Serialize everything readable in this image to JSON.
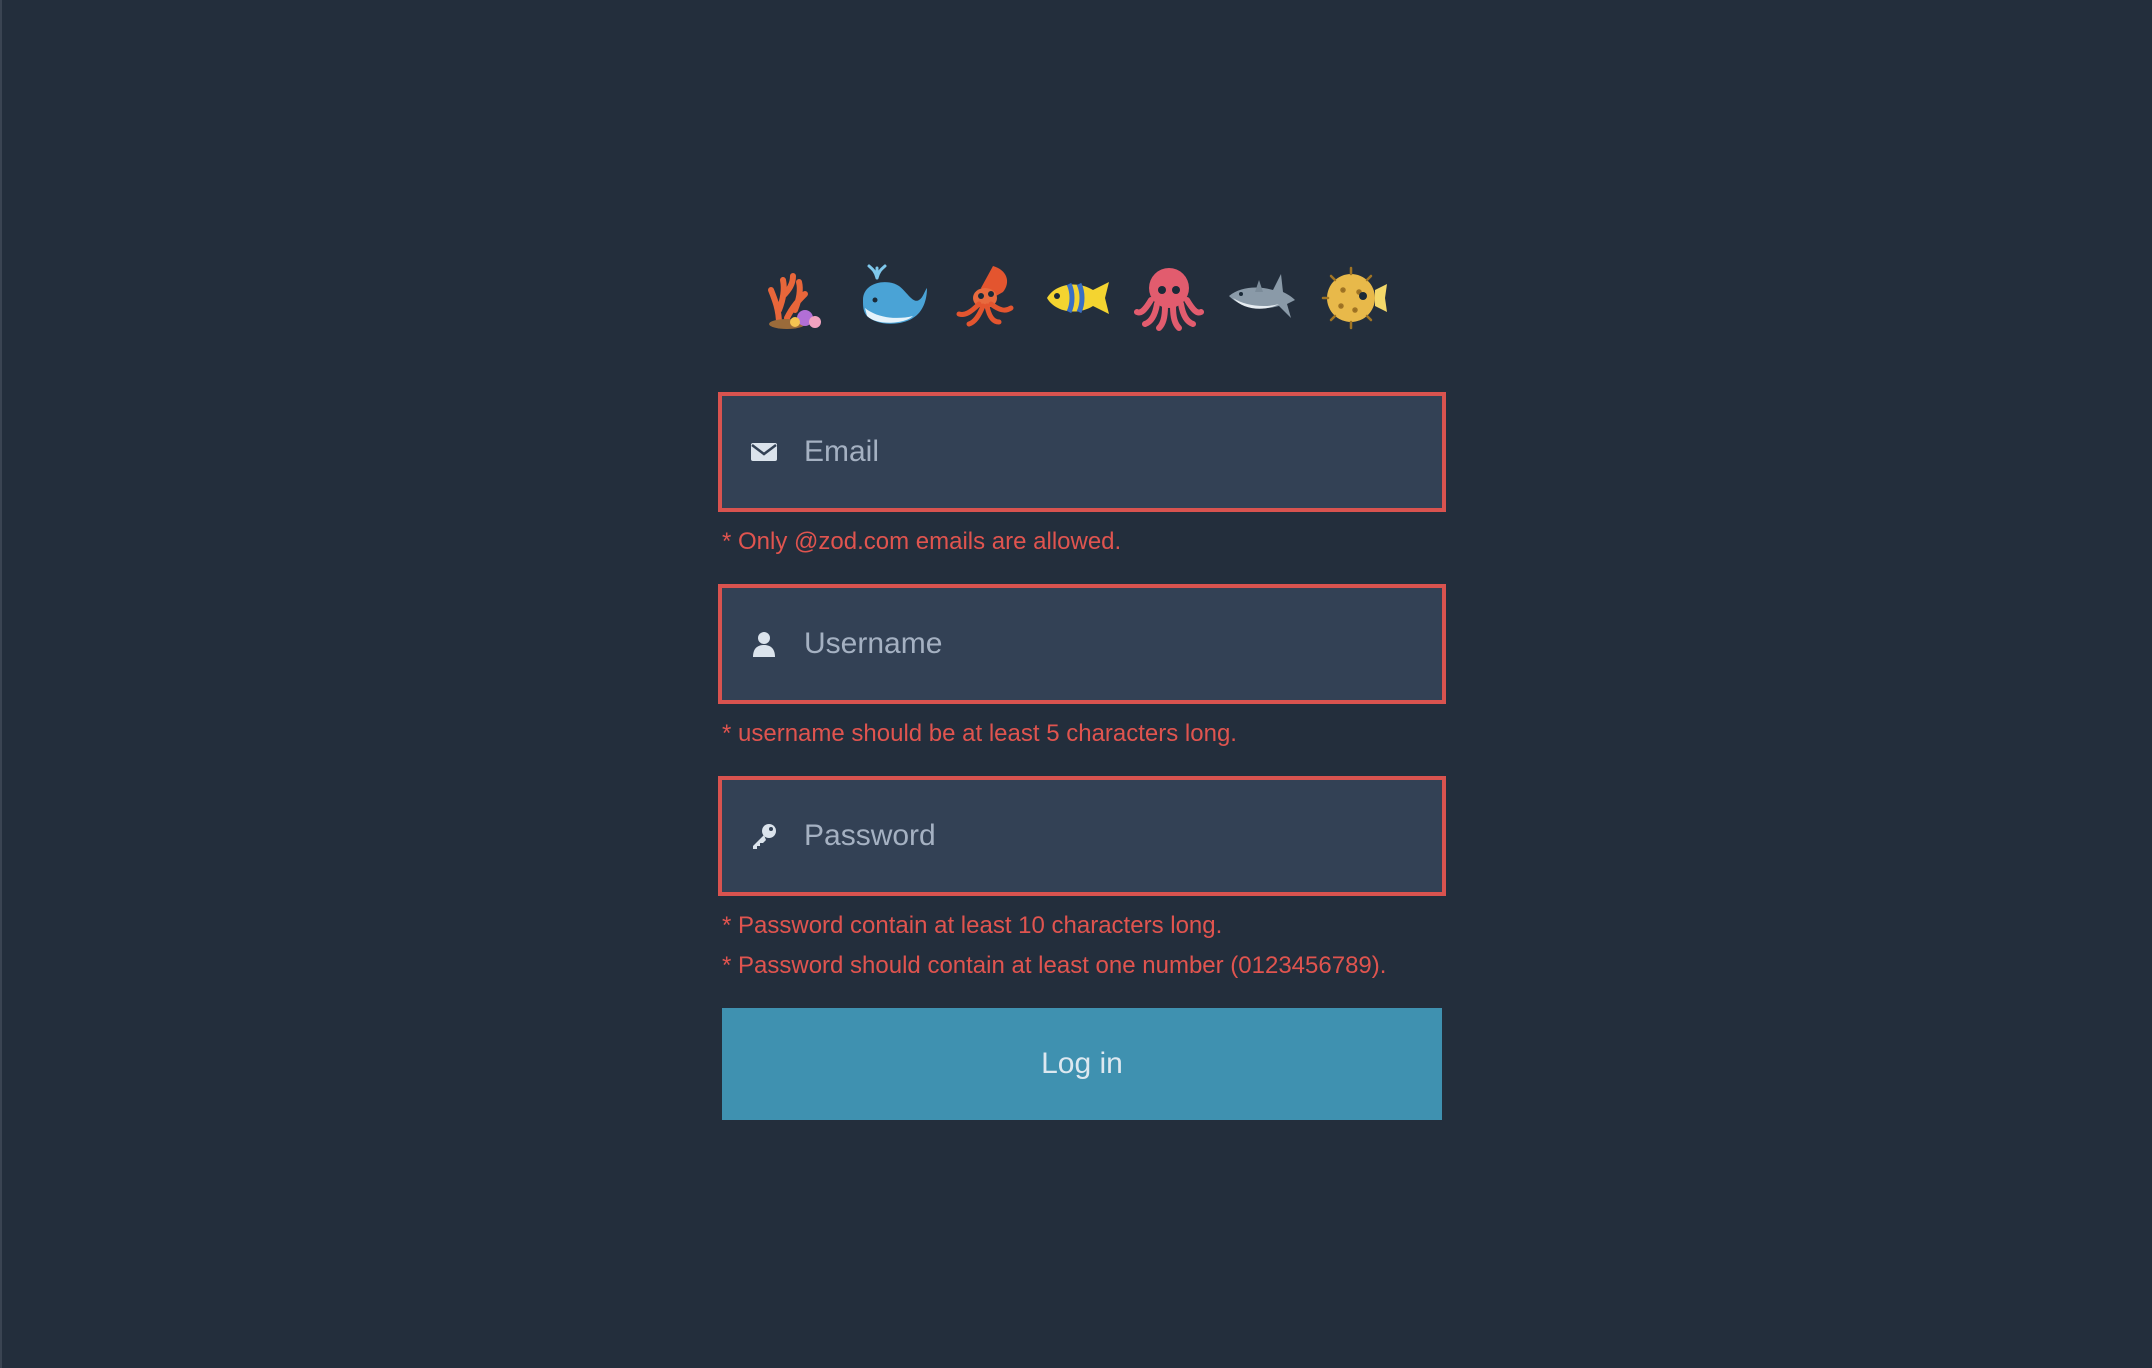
{
  "header": {
    "emojis": [
      {
        "icon": "coral-icon"
      },
      {
        "icon": "whale-icon"
      },
      {
        "icon": "squid-icon"
      },
      {
        "icon": "tropical-fish-icon"
      },
      {
        "icon": "octopus-icon"
      },
      {
        "icon": "shark-icon"
      },
      {
        "icon": "blowfish-icon"
      }
    ]
  },
  "form": {
    "email": {
      "placeholder": "Email",
      "value": "",
      "icon": "envelope-icon",
      "errors": [
        "* Only @zod.com emails are allowed."
      ]
    },
    "username": {
      "placeholder": "Username",
      "value": "",
      "icon": "user-icon",
      "errors": [
        "* username should be at least 5 characters long."
      ]
    },
    "password": {
      "placeholder": "Password",
      "value": "",
      "icon": "key-icon",
      "errors": [
        "* Password contain at least 10 characters long.",
        "* Password should contain at least one number (0123456789)."
      ]
    },
    "submit_label": "Log in"
  },
  "colors": {
    "background": "#232e3c",
    "input_background": "#334155",
    "error": "#e0544f",
    "button": "#3f91b0"
  }
}
